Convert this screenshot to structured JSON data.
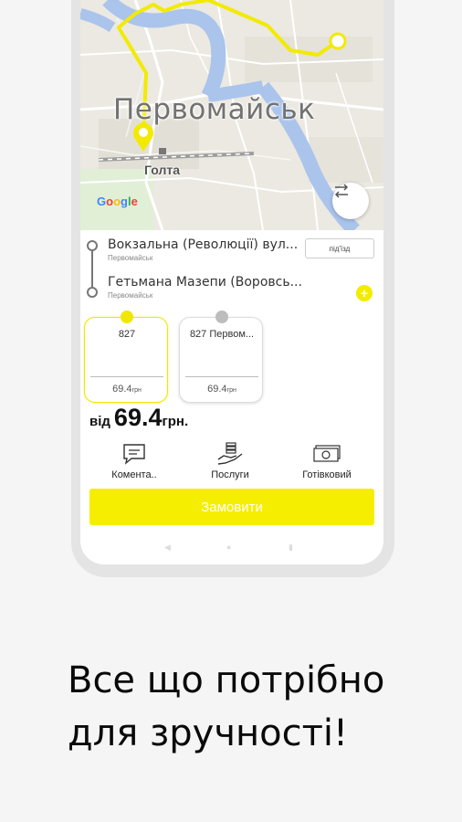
{
  "map": {
    "city_label": "Первомайськ",
    "town_label": "Голта",
    "google_logo": [
      "G",
      "o",
      "o",
      "g",
      "l",
      "e"
    ]
  },
  "route": {
    "from_address": "Вокзальна (Революції) вул...",
    "from_city": "Первомайськ",
    "entrance_button": "під'їзд",
    "to_address": "Гетьмана Мазепи (Воровсь...",
    "to_city": "Первомайськ",
    "add_stop_icon": "+"
  },
  "tariffs": [
    {
      "name": "827",
      "price": "69.4",
      "currency": "грн",
      "selected": true,
      "badge_color": "#f0e800"
    },
    {
      "name": "827 Первом...",
      "price": "69.4",
      "currency": "грн",
      "selected": false,
      "badge_color": "#bdbdbd"
    }
  ],
  "price_summary": {
    "prefix": "від",
    "value": "69.4",
    "currency": "грн."
  },
  "options": [
    {
      "label": "Комента..",
      "icon": "comment-icon"
    },
    {
      "label": "Послуги",
      "icon": "services-icon"
    },
    {
      "label": "Готівковий",
      "icon": "cash-icon"
    }
  ],
  "order_button": "Замовити",
  "tagline": {
    "line1": "Все що потрібно",
    "line2": "для зручності!"
  },
  "colors": {
    "accent": "#f6ee00",
    "route_yellow": "#f2ea00",
    "water": "#aac4ec"
  }
}
